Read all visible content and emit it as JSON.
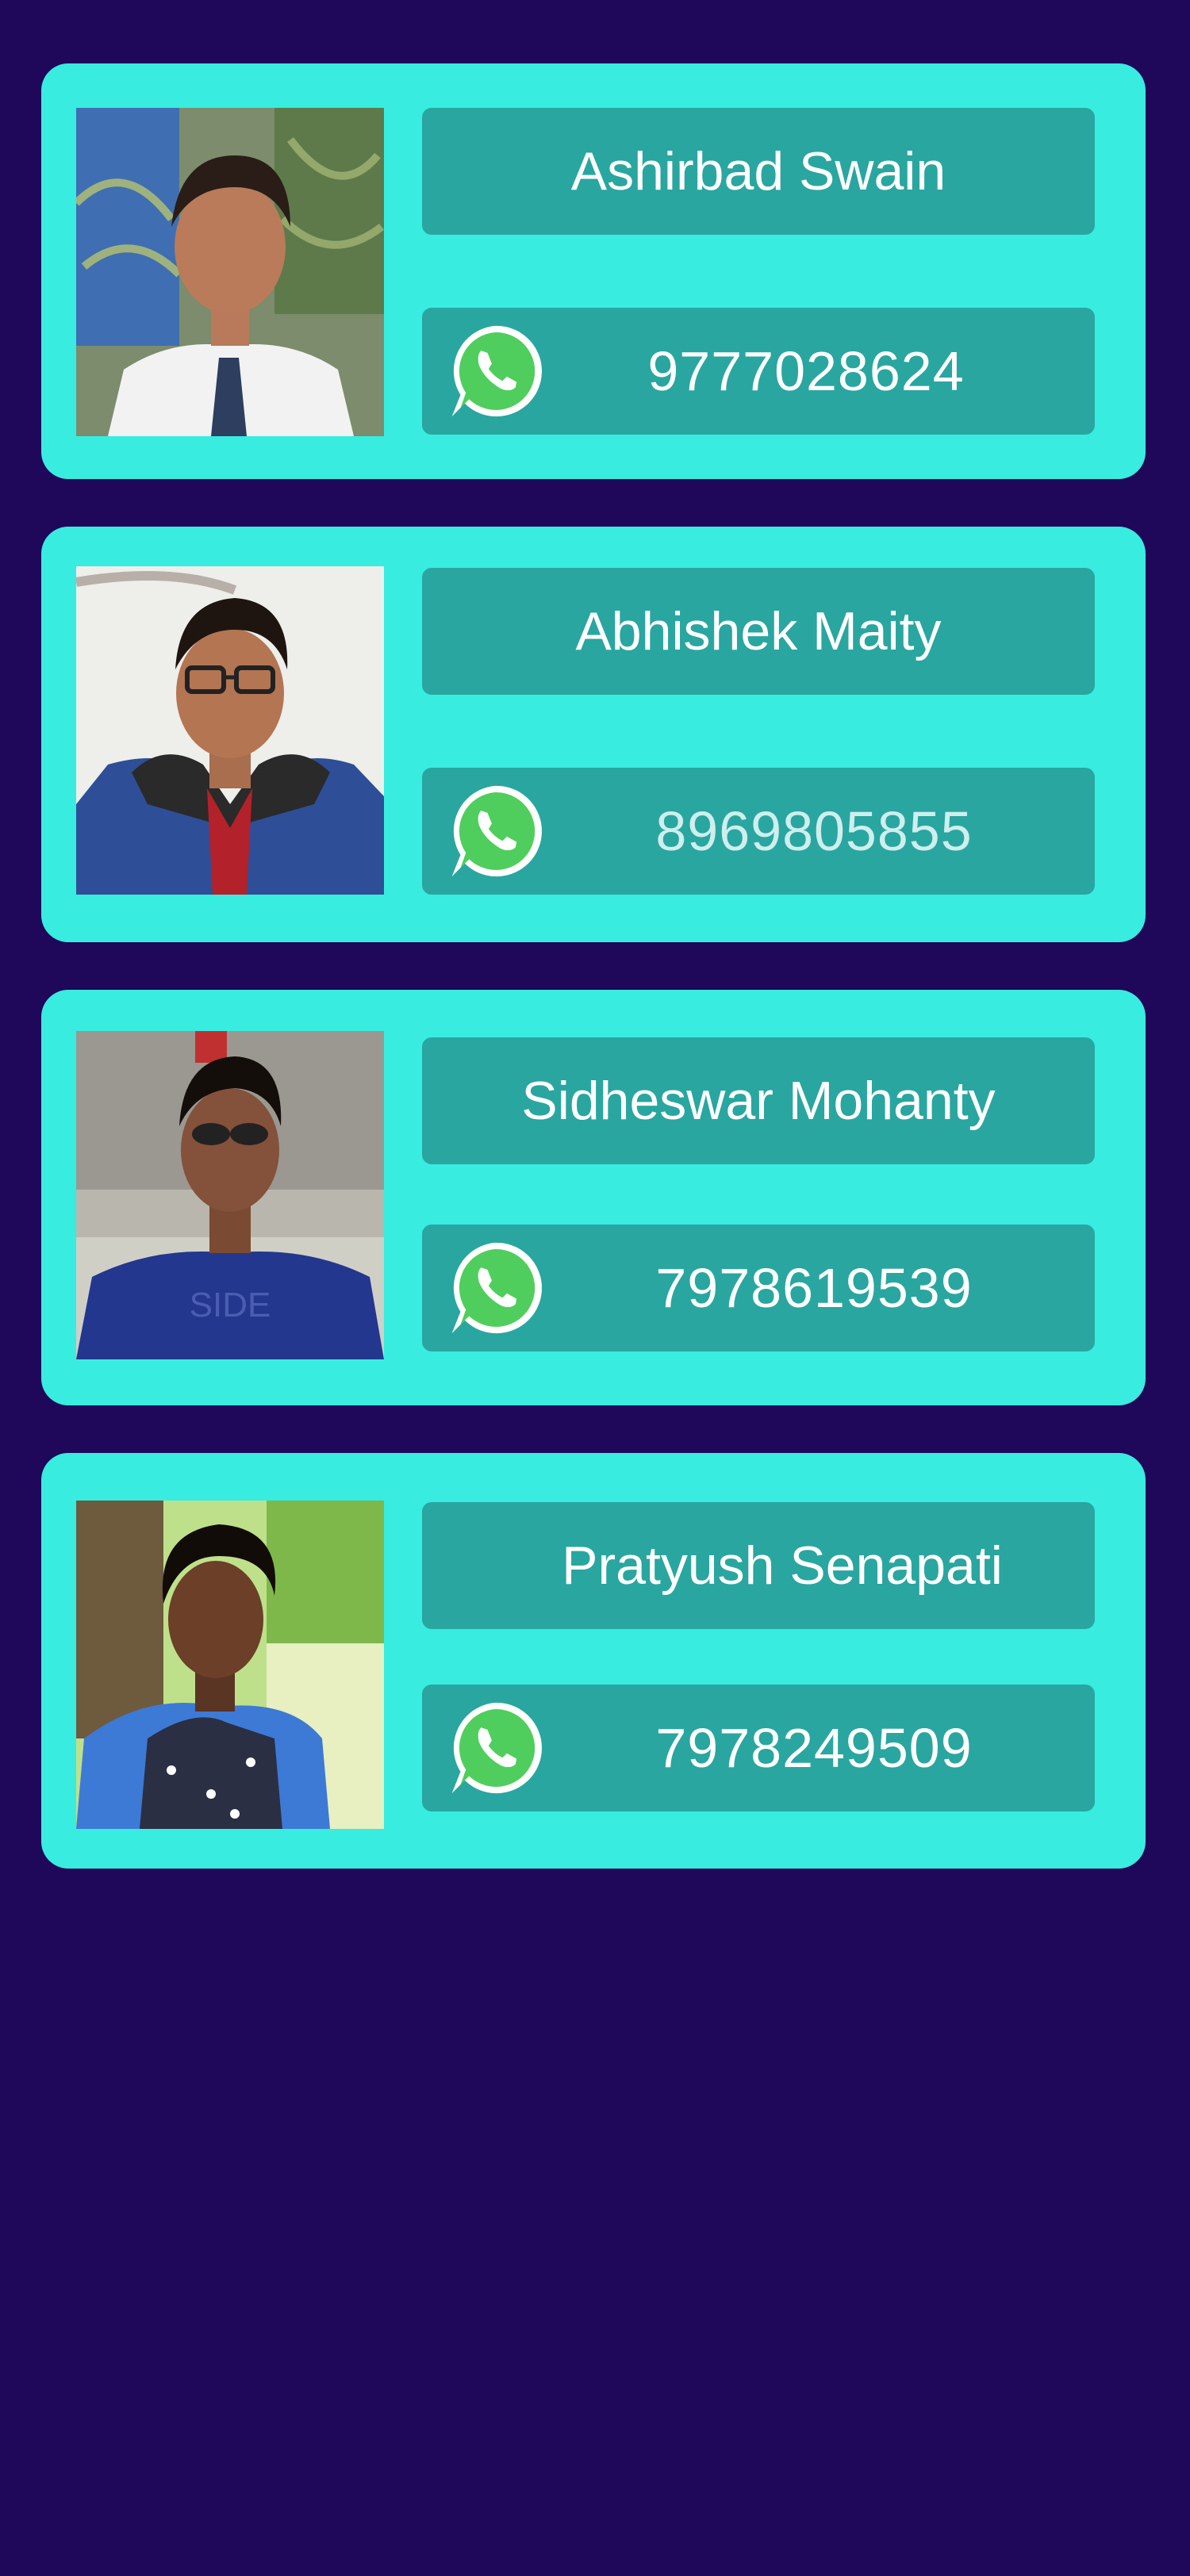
{
  "contacts": [
    {
      "name": "Ashirbad Swain",
      "phone": "9777028624",
      "photo_icon": "profile-photo",
      "messenger_icon": "whatsapp-icon"
    },
    {
      "name": "Abhishek Maity",
      "phone": "8969805855",
      "photo_icon": "profile-photo",
      "messenger_icon": "whatsapp-icon"
    },
    {
      "name": "Sidheswar Mohanty",
      "phone": "7978619539",
      "photo_icon": "profile-photo",
      "messenger_icon": "whatsapp-icon"
    },
    {
      "name": "Pratyush Senapati",
      "phone": "7978249509",
      "photo_icon": "profile-photo",
      "messenger_icon": "whatsapp-icon"
    }
  ],
  "colors": {
    "background": "#1f075a",
    "card": "#38ece0",
    "field": "#29a6a0",
    "text": "#ffffff",
    "whatsapp_green": "#4fce5d"
  }
}
